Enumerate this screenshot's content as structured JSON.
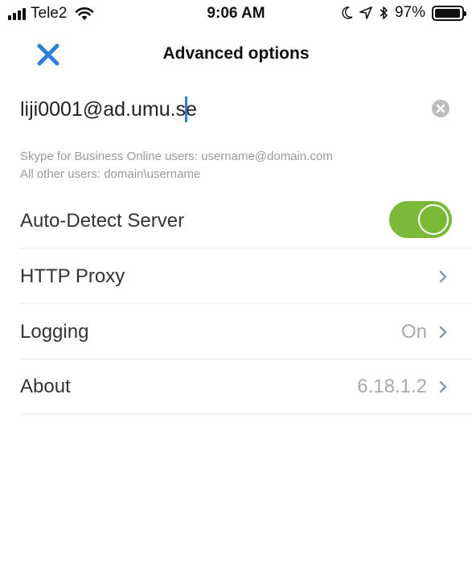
{
  "status_bar": {
    "carrier": "Tele2",
    "time": "9:06 AM",
    "battery_percent": "97%",
    "battery_level": 0.97,
    "icons": [
      "signal-icon",
      "wifi-icon",
      "moon-icon",
      "location-icon",
      "bluetooth-icon",
      "battery-icon"
    ]
  },
  "nav": {
    "title": "Advanced options",
    "close_icon": "close-icon"
  },
  "email": {
    "value": "liji0001@ad.umu.se",
    "clear_icon": "clear-circle-icon"
  },
  "hint": {
    "line1": "Skype for Business Online users: username@domain.com",
    "line2": "All other users: domain\\username"
  },
  "settings": {
    "auto_detect": {
      "label": "Auto-Detect Server",
      "enabled": true
    },
    "http_proxy": {
      "label": "HTTP Proxy"
    },
    "logging": {
      "label": "Logging",
      "value": "On"
    },
    "about": {
      "label": "About",
      "value": "6.18.1.2"
    }
  },
  "colors": {
    "accent_blue": "#2e7fd6",
    "toggle_green": "#7cb939",
    "muted_text": "#9a9a9a"
  }
}
